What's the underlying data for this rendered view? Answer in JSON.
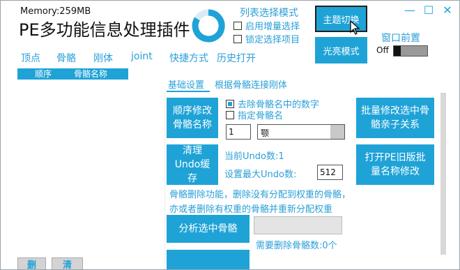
{
  "header": {
    "memory": "Memory:259MB",
    "app_title": "PE多功能信息处理插件"
  },
  "list_select": {
    "title": "列表选择模式",
    "options": [
      {
        "label": "启用增量选择",
        "checked": false
      },
      {
        "label": "锁定选择项目",
        "checked": false
      }
    ]
  },
  "buttons": {
    "theme_switch": "主题切换",
    "bright_mode": "光亮模式"
  },
  "window": {
    "minimize_icon": "—",
    "maximize_icon": "☐",
    "close_icon": "✕",
    "topmost_label": "窗口前置",
    "topmost_state": "Off"
  },
  "menu": {
    "items": [
      "顶点",
      "骨骼",
      "刚体",
      "joint",
      "快捷方式",
      "历史打开"
    ]
  },
  "bone_list": {
    "columns": [
      "顺序",
      "骨骼名称"
    ]
  },
  "subtabs": {
    "basic": "基础设置",
    "by_connection": "根据骨骼连接刚体"
  },
  "panel": {
    "sort_button": "顺序修改骨骼名称",
    "remove_digits": {
      "label": "去除骨骼名中的数字",
      "checked": true
    },
    "specify_name": {
      "label": "指定骨骼名",
      "checked": false
    },
    "index_value": "1",
    "bone_name_value": "颚",
    "batch_parent_button": "批量修改选中骨骼亲子关系",
    "clear_undo_button": "清理Undo缓存",
    "current_undo": "当前Undo数:1",
    "set_max_undo_label": "设置最大Undo数:",
    "max_undo_value": "512",
    "open_old_button": "打开PE旧版批量名称修改",
    "delete_desc_line1": "骨骼删除功能，删除没有分配到权重的骨骼，",
    "delete_desc_line2": "亦或者删除有权重的骨骼并重新分配权重",
    "analyze_button": "分析选中骨骼",
    "need_delete": "需要删除骨骼数:0个"
  },
  "bottom": {
    "delete_label": "删",
    "clear_label": "清"
  },
  "colors": {
    "accent": "#1fa3d7",
    "text_accent": "#2a9fd8"
  }
}
